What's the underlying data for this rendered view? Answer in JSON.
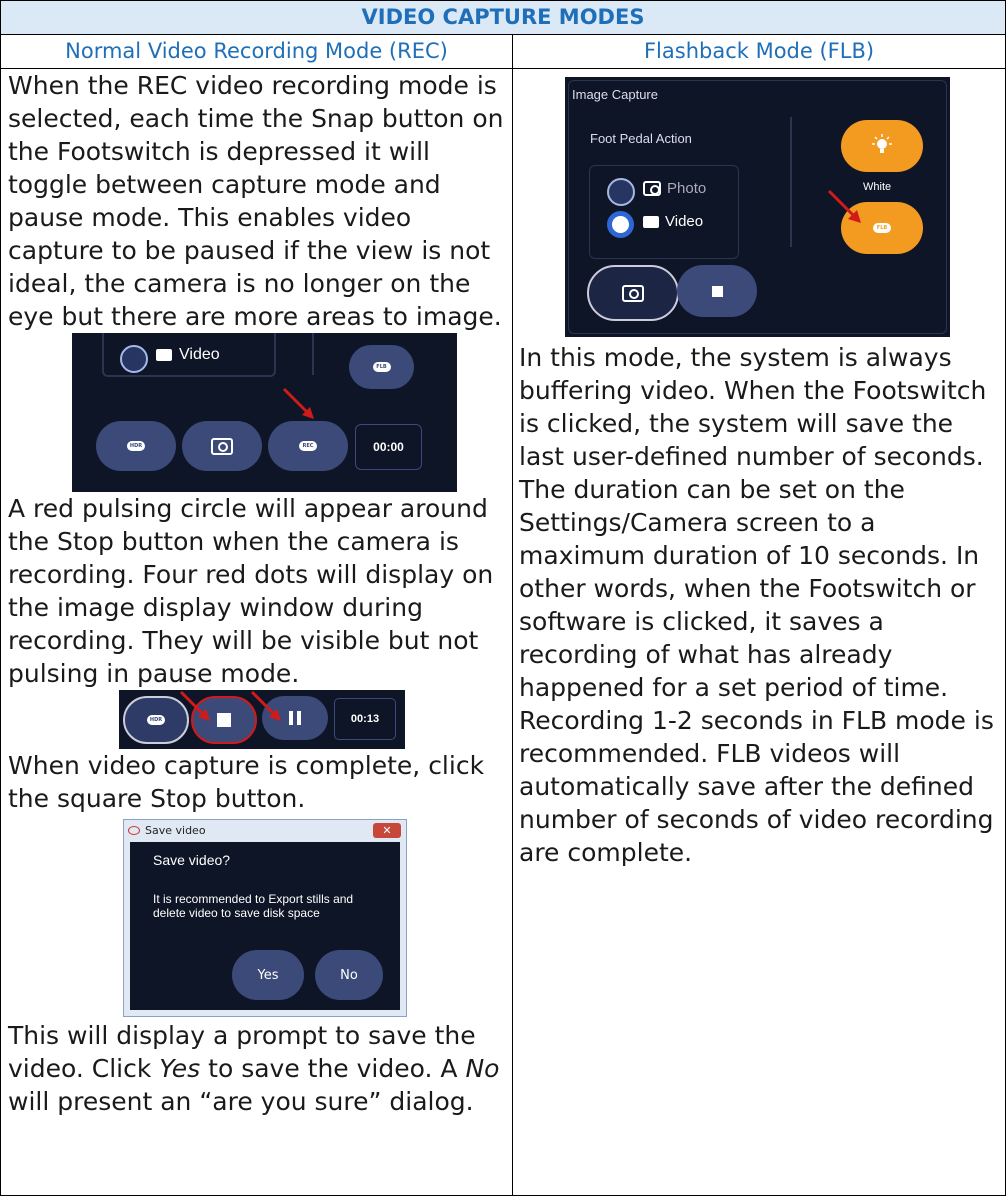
{
  "header": {
    "title": "VIDEO CAPTURE MODES"
  },
  "left": {
    "heading": "Normal Video Recording Mode (REC)",
    "para1": "When the REC video recording mode is selected, each time the Snap button on the Footswitch is depressed it will toggle between capture mode and pause mode. This enables video capture to be paused if the view is not ideal, the camera is no longer on the eye but there are more areas to image.",
    "shot1": {
      "video_label": "Video",
      "flb_label": "FLB",
      "hdr_label": "HDR",
      "rec_label": "REC",
      "timer": "00:00"
    },
    "para2": "A red pulsing circle will appear around the Stop button when the camera is recording. Four red dots will display on the image display window during recording. They will be visible but not pulsing in pause mode.",
    "shot2": {
      "hdr_label": "HDR",
      "timer": "00:13"
    },
    "para3": "When video capture is complete, click the square Stop button.",
    "dialog": {
      "title": "Save video",
      "question": "Save video?",
      "message": "It is recommended to Export stills and delete video to save disk space",
      "yes": "Yes",
      "no": "No"
    },
    "para4_a": "This will display a prompt to save the video. Click ",
    "para4_yes": "Yes",
    "para4_b": " to save the video. A ",
    "para4_no": "No",
    "para4_c": " will present an “are you sure” dialog."
  },
  "right": {
    "heading": "Flashback Mode (FLB)",
    "shot": {
      "title": "Image Capture",
      "group": "Foot Pedal Action",
      "photo": "Photo",
      "video": "Video",
      "white": "White",
      "flb": "FLB"
    },
    "para": "In this mode, the system is always buffering video. When the Footswitch is clicked, the system will save the last user-defined number of seconds. The duration can be set on the Settings/Camera screen to a maximum duration of 10 seconds. In other words, when the Footswitch or software is clicked, it saves a recording of what has already happened for a set period of time. Recording 1-2 seconds in FLB mode is recommended. FLB videos will automatically save after the defined number of seconds of video recording are complete."
  },
  "colors": {
    "heading_blue": "#1f6fb8",
    "header_bg": "#dbe9f7",
    "panel_bg": "#0e1526",
    "pill": "#3c4a7a",
    "orange": "#f39a21",
    "red": "#d11a1a"
  }
}
